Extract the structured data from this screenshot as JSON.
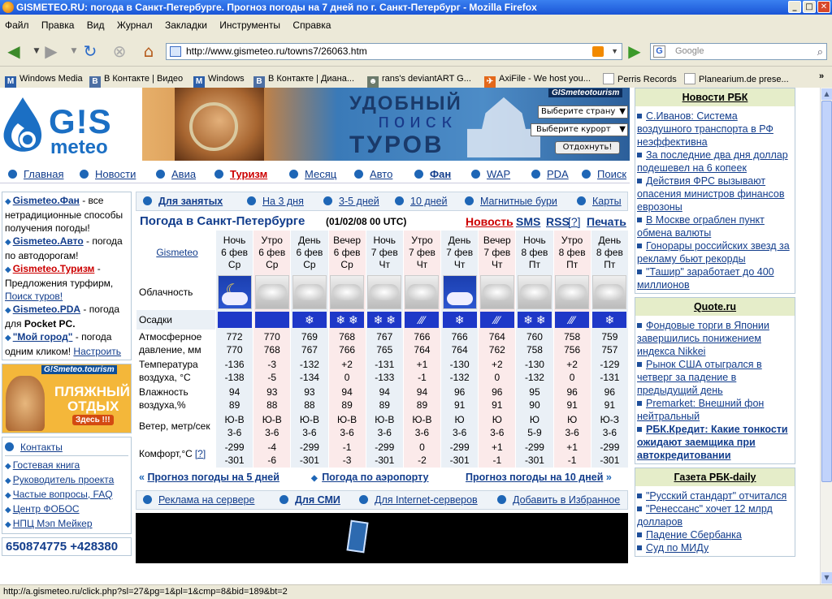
{
  "window": {
    "title": "GISMETEO.RU: погода в Санкт-Петербурге. Прогноз погоды на 7 дней по г. Санкт-Петербург - Mozilla Firefox"
  },
  "menu": [
    "Файл",
    "Правка",
    "Вид",
    "Журнал",
    "Закладки",
    "Инструменты",
    "Справка"
  ],
  "url": "http://www.gismeteo.ru/towns7/26063.htm",
  "search_placeholder": "Google",
  "bookmarks": [
    "Windows Media",
    "В Контакте | Видео",
    "Windows",
    "В Контакте | Диана...",
    "rans's deviantART G...",
    "AxiFile - We host you...",
    "Perris Records",
    "Planearium.de prese..."
  ],
  "logo": {
    "line1": "G!S",
    "line2": "meteo"
  },
  "banner": {
    "t1": "УДОБНЫЙ",
    "t2": "поиск",
    "t3": "ТУРОВ",
    "brand": "GISmeteotourism",
    "country": "Выберите страну",
    "resort": "Выберите курорт",
    "go": "Отдохнуть!"
  },
  "nav1": [
    "Главная",
    "Новости",
    "Авиа",
    "Туризм",
    "Месяц",
    "Авто",
    "Фан",
    "WAP",
    "PDA",
    "Поиск"
  ],
  "sidebar": {
    "fan_link": "Gismeteo.Фан",
    "fan_text": " - все нетрадиционные способы получения погоды!",
    "auto_link": "Gismeteo.Авто",
    "auto_text": " - погода по автодорогам!",
    "tour_link": "Gismeteo.Туризм",
    "tour_text": " - Предложения турфирм,",
    "tour_search": "Поиск туров!",
    "pda_link": "Gismeteo.PDA",
    "pda_text1": " - погода для ",
    "pda_text2": "Pocket PC.",
    "city_link": "\"Мой город\"",
    "city_text": " - погода одним кликом! ",
    "city_setup": "Настроить",
    "ad_brand": "G!Smeteo.tourism",
    "ad_t1": "ПЛЯЖНЫЙ",
    "ad_t2": "ОТДЫХ",
    "ad_btn": "Здесь !!!",
    "contacts": "Контакты",
    "links": [
      "Гостевая книга",
      "Руководитель проекта",
      "Частые вопросы, FAQ",
      "Центр ФОБОС",
      "НПЦ Мэп Мейкер"
    ],
    "phone": "650874775 +428380"
  },
  "nav2": [
    "Для занятых",
    "На 3 дня",
    "3-5 дней",
    "10 дней",
    "Магнитные бури",
    "Карты"
  ],
  "heading": {
    "title": "Погода в Санкт-Петербурге",
    "time": "(01/02/08 00 UTC)",
    "news": "Новость",
    "sms": "SMS",
    "rss": "RSS",
    "rss_q": "[?]",
    "print": "Печать"
  },
  "forecast": {
    "source": "Gismeteo",
    "cols": [
      {
        "p": "Ночь",
        "d": "6 фев",
        "w": "Ср",
        "sky": "night",
        "pr": "none",
        "t1": "772",
        "t2": "770",
        "temp1": "-136",
        "temp2": "-138",
        "h1": "94",
        "h2": "89",
        "wd": "Ю-В",
        "ws": "3-6",
        "c1": "-299",
        "c2": "-301"
      },
      {
        "p": "Утро",
        "d": "6 фев",
        "w": "Ср",
        "sky": "cloud",
        "pr": "none",
        "t1": "770",
        "t2": "768",
        "temp1": "-3",
        "temp2": "-5",
        "h1": "93",
        "h2": "88",
        "wd": "Ю-В",
        "ws": "3-6",
        "c1": "-4",
        "c2": "-6"
      },
      {
        "p": "День",
        "d": "6 фев",
        "w": "Ср",
        "sky": "cloud",
        "pr": "snow",
        "t1": "769",
        "t2": "767",
        "temp1": "-132",
        "temp2": "-134",
        "h1": "93",
        "h2": "88",
        "wd": "Ю-В",
        "ws": "3-6",
        "c1": "-299",
        "c2": "-301"
      },
      {
        "p": "Вечер",
        "d": "6 фев",
        "w": "Ср",
        "sky": "cloud",
        "pr": "snow2",
        "t1": "768",
        "t2": "766",
        "temp1": "+2",
        "temp2": "0",
        "h1": "94",
        "h2": "89",
        "wd": "Ю-В",
        "ws": "3-6",
        "c1": "-1",
        "c2": "-3"
      },
      {
        "p": "Ночь",
        "d": "7 фев",
        "w": "Чт",
        "sky": "cloud",
        "pr": "snow2",
        "t1": "767",
        "t2": "765",
        "temp1": "-131",
        "temp2": "-133",
        "h1": "94",
        "h2": "89",
        "wd": "Ю-В",
        "ws": "3-6",
        "c1": "-299",
        "c2": "-301"
      },
      {
        "p": "Утро",
        "d": "7 фев",
        "w": "Чт",
        "sky": "cloud",
        "pr": "rain",
        "t1": "766",
        "t2": "764",
        "temp1": "+1",
        "temp2": "-1",
        "h1": "94",
        "h2": "89",
        "wd": "Ю-В",
        "ws": "3-6",
        "c1": "0",
        "c2": "-2"
      },
      {
        "p": "День",
        "d": "7 фев",
        "w": "Чт",
        "sky": "nightcloud",
        "pr": "snow",
        "t1": "766",
        "t2": "764",
        "temp1": "-130",
        "temp2": "-132",
        "h1": "96",
        "h2": "91",
        "wd": "Ю",
        "ws": "3-6",
        "c1": "-299",
        "c2": "-301"
      },
      {
        "p": "Вечер",
        "d": "7 фев",
        "w": "Чт",
        "sky": "cloud",
        "pr": "rain",
        "t1": "764",
        "t2": "762",
        "temp1": "+2",
        "temp2": "0",
        "h1": "96",
        "h2": "91",
        "wd": "Ю",
        "ws": "3-6",
        "c1": "+1",
        "c2": "-1"
      },
      {
        "p": "Ночь",
        "d": "8 фев",
        "w": "Пт",
        "sky": "cloud",
        "pr": "snow2",
        "t1": "760",
        "t2": "758",
        "temp1": "-130",
        "temp2": "-132",
        "h1": "95",
        "h2": "90",
        "wd": "Ю",
        "ws": "5-9",
        "c1": "-299",
        "c2": "-301"
      },
      {
        "p": "Утро",
        "d": "8 фев",
        "w": "Пт",
        "sky": "cloud",
        "pr": "rain",
        "t1": "758",
        "t2": "756",
        "temp1": "+2",
        "temp2": "0",
        "h1": "96",
        "h2": "91",
        "wd": "Ю",
        "ws": "3-6",
        "c1": "+1",
        "c2": "-1"
      },
      {
        "p": "День",
        "d": "8 фев",
        "w": "Пт",
        "sky": "cloud",
        "pr": "snow",
        "t1": "759",
        "t2": "757",
        "temp1": "-129",
        "temp2": "-131",
        "h1": "96",
        "h2": "91",
        "wd": "Ю-З",
        "ws": "3-6",
        "c1": "-299",
        "c2": "-301"
      }
    ],
    "labels": {
      "clouds": "Облачность",
      "precip": "Осадки",
      "press": "Атмосферное давление, мм",
      "temp": "Температура воздуха, °С",
      "hum": "Влажность воздуха,%",
      "wind": "Ветер, метр/сек",
      "comfort": "Комфорт,°С",
      "comfort_q": "[?]"
    }
  },
  "bottom_nav": {
    "f5": "Прогноз погоды на 5 дней",
    "airport": "Погода по аэропорту",
    "f10": "Прогноз погоды на 10 дней"
  },
  "nav3": [
    "Реклама на сервере",
    "Для СМИ",
    "Для Internet-серверов",
    "Добавить в Избранное"
  ],
  "right": {
    "rbk_title": "Новости РБК",
    "rbk": [
      "С.Иванов: Система воздушного транспорта в РФ неэффективна",
      "За последние два дня доллар подешевел на 6 копеек",
      "Действия ФРС вызывают опасения министров финансов еврозоны",
      "В Москве ограблен пункт обмена валюты",
      "Гонорары российских звезд за рекламу бьют рекорды",
      "\"Ташир\" заработает до 400 миллионов"
    ],
    "quote_title": "Quote.ru",
    "quote": [
      "Фондовые торги в Японии завершились понижением индекса Nikkei",
      "Рынок США отыгрался в четверг за падение в предыдущий день",
      "Premarket: Внешний фон нейтральный",
      "РБК.Кредит: Какие тонкости ожидают заемщика при автокредитовании"
    ],
    "daily_title": "Газета РБК-daily",
    "daily": [
      "\"Русский стандарт\" отчитался",
      "\"Ренессанс\" хочет 12 млрд долларов",
      "Падение Сбербанка",
      "Суд по МИДу"
    ]
  },
  "status": "http://a.gismeteo.ru/click.php?sl=27&pg=1&pl=1&cmp=8&bid=189&bt=2",
  "colors": {
    "title_bar": "#1a55d6",
    "link": "#123d8c",
    "accent_red": "#cc0000",
    "precip_blue": "#1e38c8"
  }
}
